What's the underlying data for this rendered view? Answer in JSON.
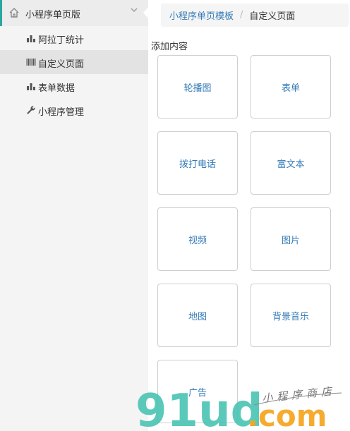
{
  "sidebar": {
    "header_title": "小程序单页版",
    "items": [
      {
        "label": "阿拉丁统计",
        "icon": "bar-chart-icon",
        "active": false
      },
      {
        "label": "自定义页面",
        "icon": "barcode-icon",
        "active": true
      },
      {
        "label": "表单数据",
        "icon": "bar-chart-icon",
        "active": false
      },
      {
        "label": "小程序管理",
        "icon": "wrench-icon",
        "active": false
      }
    ]
  },
  "breadcrumb": {
    "parent": "小程序单页模板",
    "separator": "/",
    "current": "自定义页面"
  },
  "main": {
    "section_label": "添加内容",
    "cards": [
      {
        "label": "轮播图"
      },
      {
        "label": "表单"
      },
      {
        "label": "拨打电话"
      },
      {
        "label": "富文本"
      },
      {
        "label": "视频"
      },
      {
        "label": "图片"
      },
      {
        "label": "地图"
      },
      {
        "label": "背景音乐"
      },
      {
        "label": "广告"
      }
    ]
  },
  "watermark": {
    "logo_text": "91ud",
    "suffix": ".com",
    "tagline": "小程序商店"
  },
  "colors": {
    "accent": "#2aa6a0",
    "link": "#337ab7",
    "sidebar_bg": "#f4f4f4",
    "active_bg": "#e3e3e3",
    "card_border": "#cfcfcf",
    "watermark_green": "#4cc4b4",
    "watermark_orange": "#f5a623"
  }
}
